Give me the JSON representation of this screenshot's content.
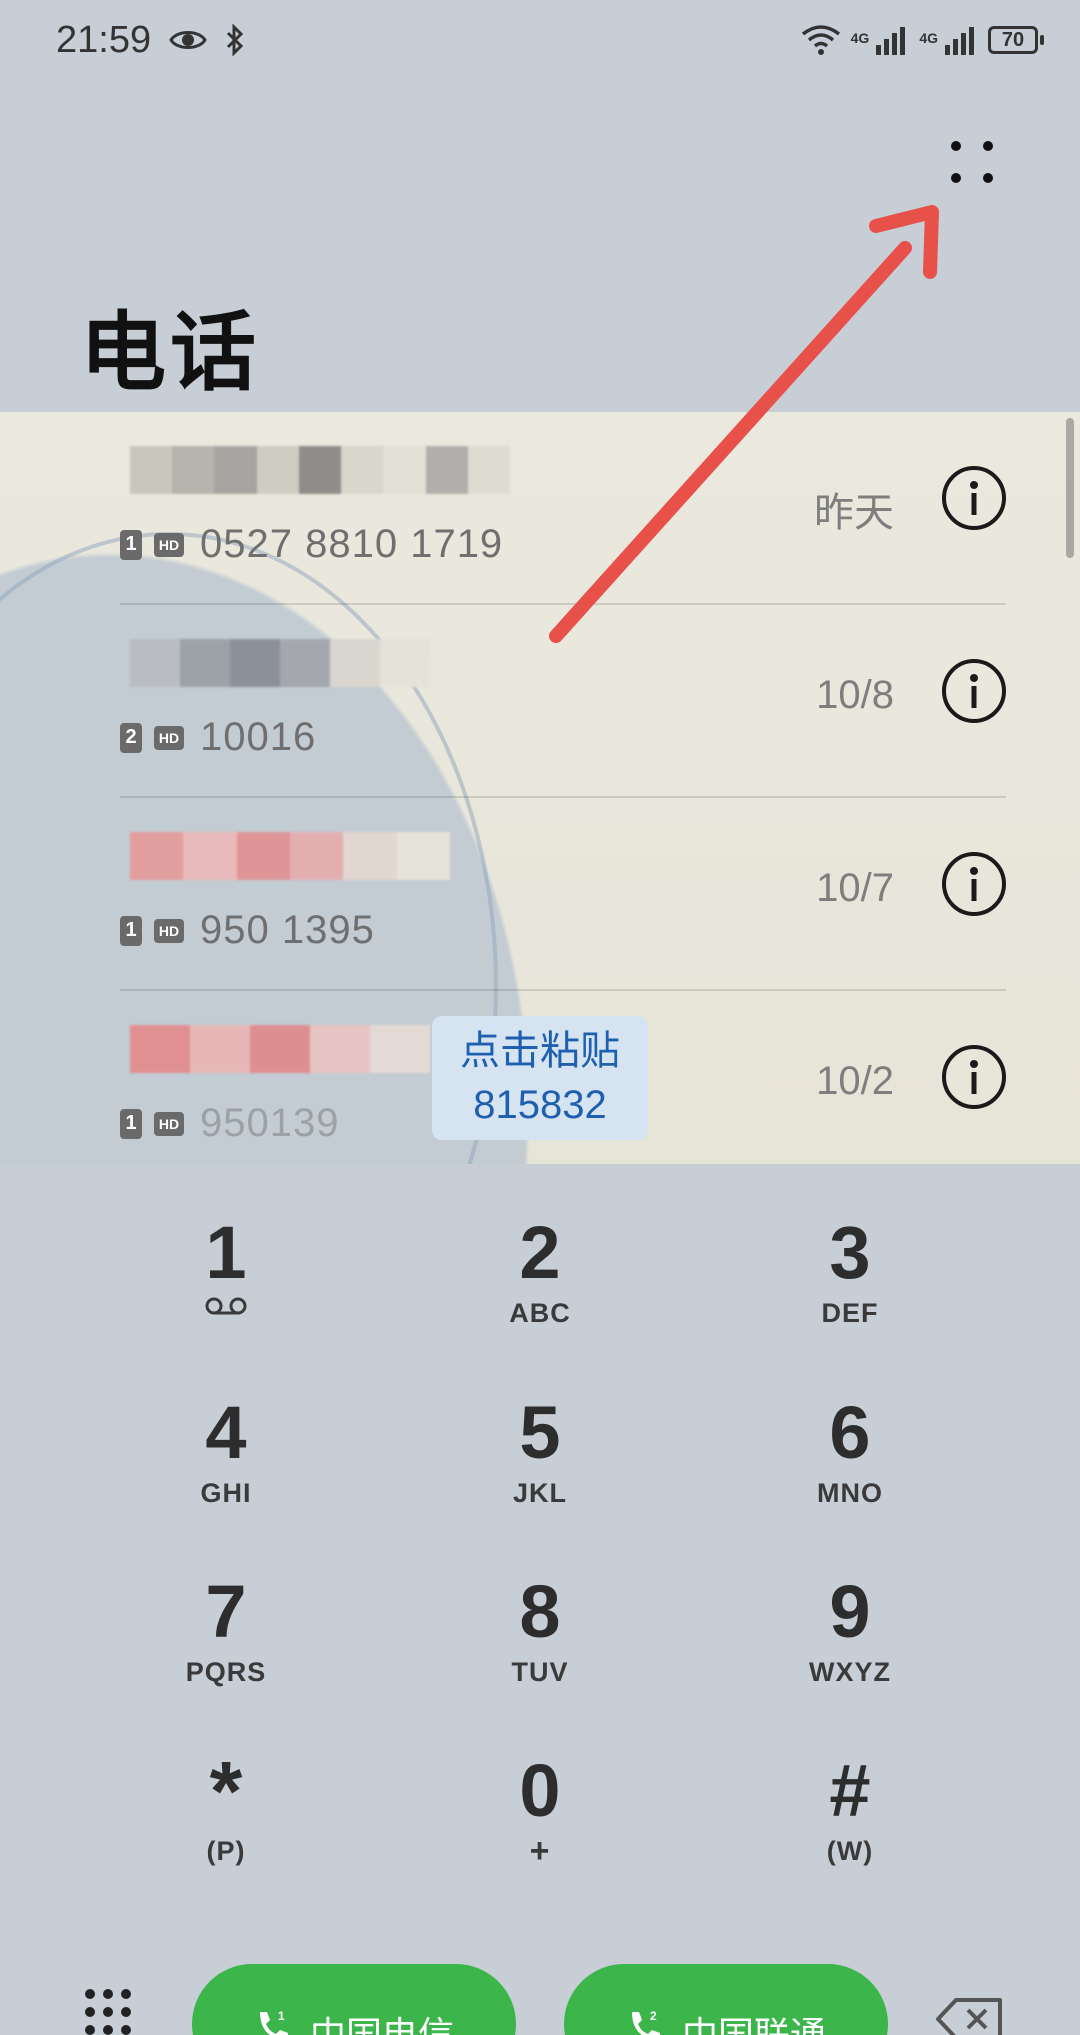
{
  "status_bar": {
    "time": "21:59",
    "network_1": "4G",
    "network_2": "4G",
    "battery": "70"
  },
  "header": {
    "title": "电话"
  },
  "recents": [
    {
      "sim": "1",
      "hd": "HD",
      "number": "0527 8810 1719",
      "date": "昨天"
    },
    {
      "sim": "2",
      "hd": "HD",
      "number": "10016",
      "date": "10/8"
    },
    {
      "sim": "1",
      "hd": "HD",
      "number": "950 1395",
      "date": "10/7"
    },
    {
      "sim": "1",
      "hd": "HD",
      "number": "950139",
      "date": "10/2"
    }
  ],
  "paste_chip": {
    "label": "点击粘贴",
    "code": "815832"
  },
  "keypad": [
    {
      "digit": "1",
      "letters": "oo"
    },
    {
      "digit": "2",
      "letters": "ABC"
    },
    {
      "digit": "3",
      "letters": "DEF"
    },
    {
      "digit": "4",
      "letters": "GHI"
    },
    {
      "digit": "5",
      "letters": "JKL"
    },
    {
      "digit": "6",
      "letters": "MNO"
    },
    {
      "digit": "7",
      "letters": "PQRS"
    },
    {
      "digit": "8",
      "letters": "TUV"
    },
    {
      "digit": "9",
      "letters": "WXYZ"
    },
    {
      "digit": "*",
      "letters": "(P)"
    },
    {
      "digit": "0",
      "letters": "+"
    },
    {
      "digit": "#",
      "letters": "(W)"
    }
  ],
  "call_buttons": [
    {
      "sim": "1",
      "label": "中国电信"
    },
    {
      "sim": "2",
      "label": "中国联通"
    }
  ],
  "colors": {
    "call_green": "#3cb54a",
    "annotation_red": "#e8504a",
    "paste_blue": "#1f5fb0"
  }
}
